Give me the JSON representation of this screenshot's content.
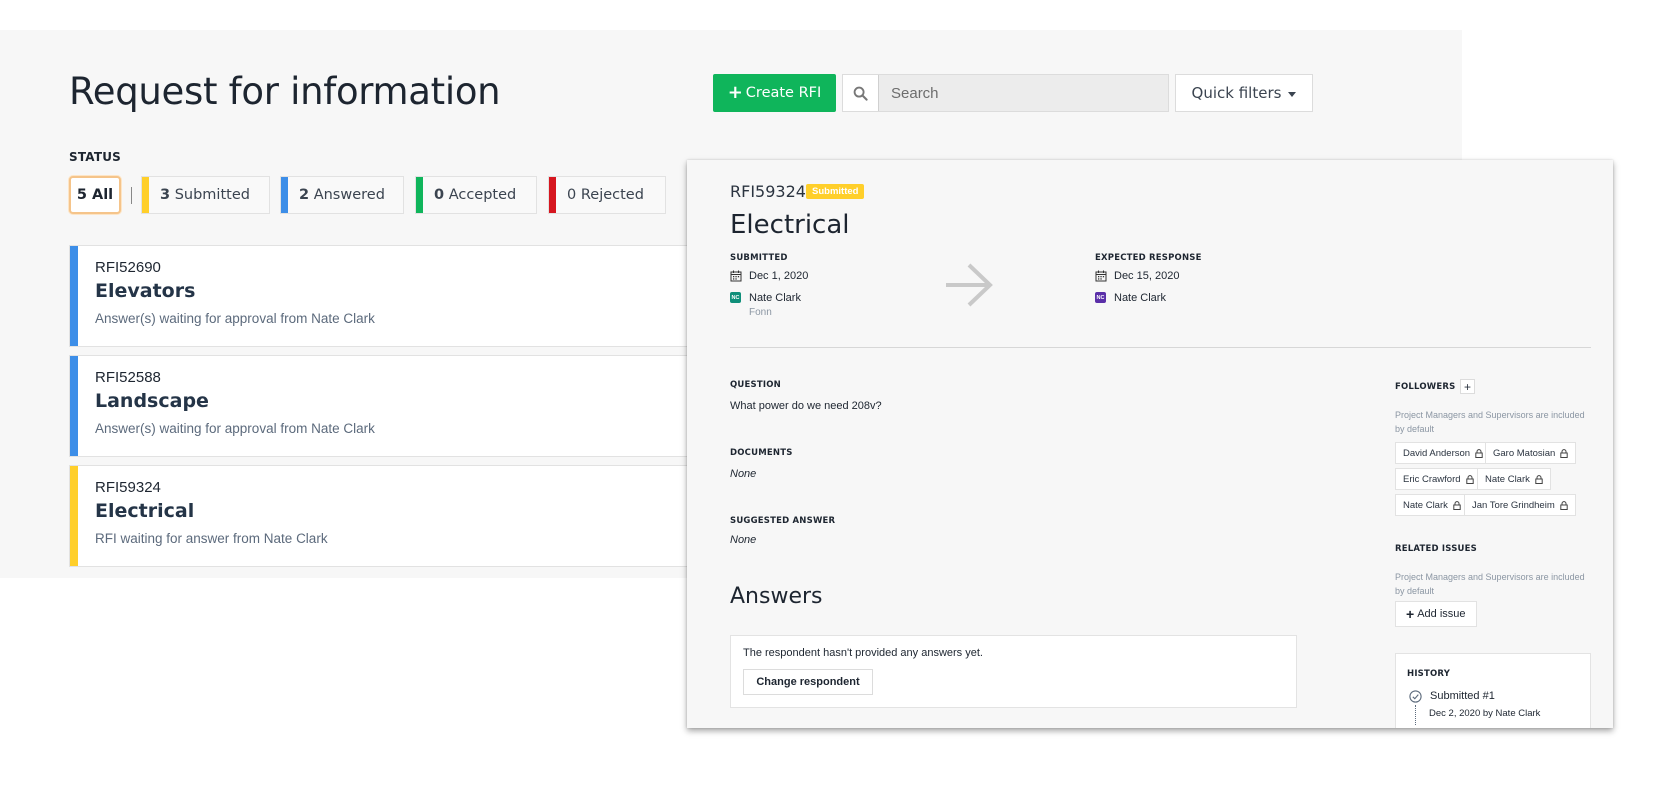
{
  "header": {
    "title": "Request for information",
    "create_label": "Create RFI",
    "search": {
      "placeholder": "Search",
      "value": ""
    },
    "quick_filters_label": "Quick filters"
  },
  "status": {
    "label": "STATUS",
    "chips": [
      {
        "count": "5",
        "label": "All"
      },
      {
        "count": "3",
        "label": "Submitted",
        "color": "#ffcf2a"
      },
      {
        "count": "2",
        "label": "Answered",
        "color": "#3d8ee8"
      },
      {
        "count": "0",
        "label": "Accepted",
        "color": "#0fb55b"
      },
      {
        "count": "0",
        "label": "Rejected",
        "color": "#d6161f"
      }
    ]
  },
  "rfis": [
    {
      "id": "RFI52690",
      "title": "Elevators",
      "subtitle": "Answer(s) waiting for approval from Nate Clark",
      "color": "#3d8ee8"
    },
    {
      "id": "RFI52588",
      "title": "Landscape",
      "subtitle": "Answer(s) waiting for approval from Nate Clark",
      "color": "#3d8ee8"
    },
    {
      "id": "RFI59324",
      "title": "Electrical",
      "subtitle": "RFI waiting for answer from Nate Clark",
      "color": "#ffcf2a"
    }
  ],
  "detail": {
    "id": "RFI59324",
    "badge": "Submitted",
    "title": "Electrical",
    "submitted": {
      "label": "SUBMITTED",
      "date": "Dec 1, 2020",
      "initials": "NC",
      "person": "Nate Clark",
      "company": "Fonn",
      "avatar_color": "#0f8f7a"
    },
    "expected": {
      "label": "EXPECTED RESPONSE",
      "date": "Dec 15, 2020",
      "initials": "NC",
      "person": "Nate Clark",
      "avatar_color": "#5a2fa8"
    },
    "question": {
      "label": "QUESTION",
      "text": "What power do we need 208v?"
    },
    "documents": {
      "label": "DOCUMENTS",
      "text": "None"
    },
    "suggested": {
      "label": "SUGGESTED ANSWER",
      "text": "None"
    },
    "answers": {
      "heading": "Answers",
      "empty_text": "The respondent hasn't provided any answers yet.",
      "change_label": "Change respondent"
    },
    "followers": {
      "label": "FOLLOWERS",
      "note": "Project Managers and Supervisors are included by default",
      "people": [
        "David Anderson",
        "Garo Matosian",
        "Eric Crawford",
        "Nate Clark",
        "Nate Clark",
        "Jan Tore Grindheim"
      ]
    },
    "related": {
      "label": "RELATED ISSUES",
      "note": "Project Managers and Supervisors are included by default",
      "add_label": "Add issue"
    },
    "history": {
      "label": "HISTORY",
      "entry_title": "Submitted #1",
      "entry_meta": "Dec 2, 2020 by Nate Clark"
    }
  },
  "icons": [
    "search-icon",
    "plus-icon",
    "caret-down-icon",
    "calendar-icon",
    "arrow-right-icon",
    "lock-icon",
    "check-circle-icon"
  ]
}
